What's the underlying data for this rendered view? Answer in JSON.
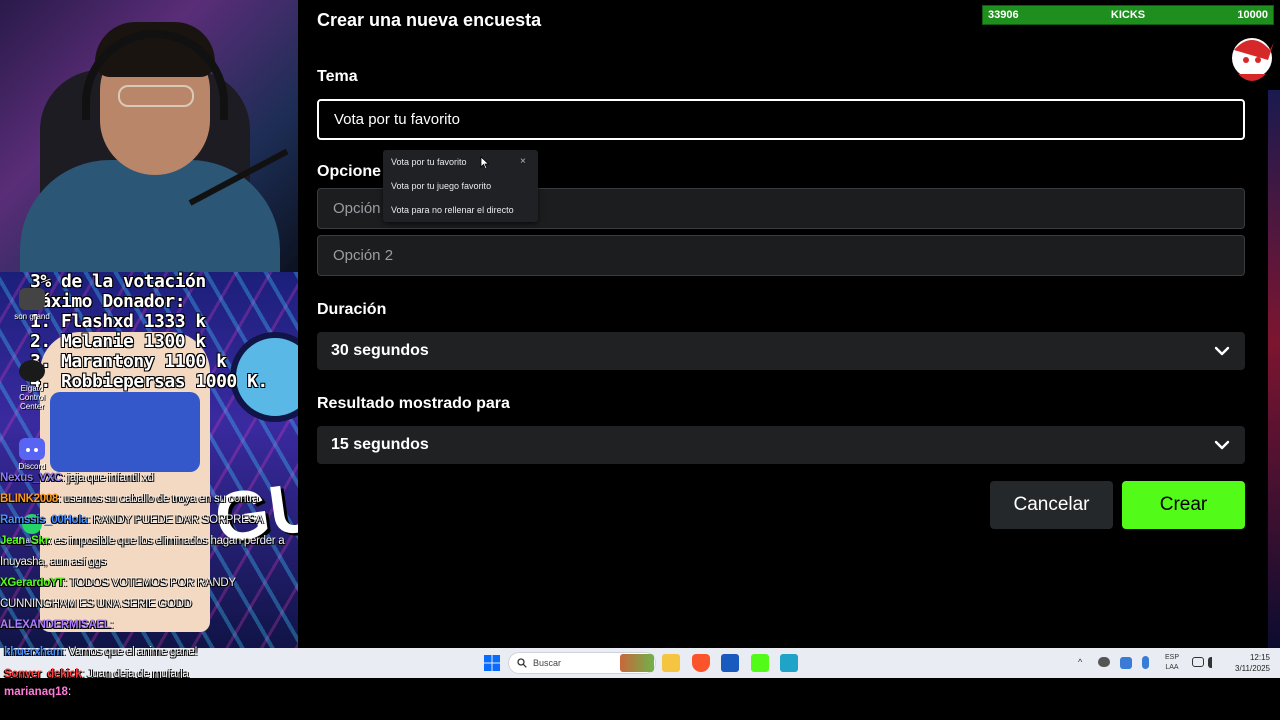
{
  "dialog": {
    "title": "Crear una nueva encuesta",
    "topic_label": "Tema",
    "topic_value": "Vota por tu favorito",
    "options_label": "Opcione",
    "option1_placeholder": "Opción",
    "option2_placeholder": "Opción 2",
    "duration_label": "Duración",
    "duration_value": "30 segundos",
    "result_label": "Resultado mostrado para",
    "result_value": "15 segundos",
    "cancel_label": "Cancelar",
    "create_label": "Crear",
    "accent_color": "#53fc18"
  },
  "autocomplete": {
    "items": [
      "Vota por tu favorito",
      "Vota por tu juego favorito",
      "Vota para no rellenar el directo"
    ],
    "close": "×"
  },
  "kicks": {
    "current": "33906",
    "label": "KICKS",
    "goal": "10000"
  },
  "donors": [
    "3% de la votación",
    "Máximo Donador:",
    "1. Flashxd 1333 k",
    "2. Melanie 1300 k",
    "3. Marantony 1100 k",
    "4. Robbiepersas 1000 K."
  ],
  "desktop": {
    "discord": "Discord",
    "elgato": "Elgato Control Center",
    "whatsapp": "WhatsApp",
    "sound": "son grand"
  },
  "chat": [
    {
      "user": "Nexus_VXC",
      "msg": ": jaja que infantil xd",
      "color": "#8e7cff"
    },
    {
      "user": "BLINK2008",
      "msg": ": usemos su caballo de troya en su contra",
      "color": "#ff9a1f"
    },
    {
      "user": "Ramssis_00Hola",
      "msg": ": RANDY PUEDE DAR SORPRESA",
      "color": "#4a90ff"
    },
    {
      "user": "Jean_Skr",
      "msg": ": es imposible que los eliminados hagan perder a Inuyasha, aun así ggs",
      "color": "#53fc18"
    },
    {
      "user": "XGerardoYT",
      "msg": ": TODOS VOTEMOS POR RANDY CUNNINGHAM ES UNA SERIE GODD",
      "color": "#53fc18"
    },
    {
      "user": "ALEXANDERMISAEL",
      "msg": ":",
      "color": "#b07cff"
    },
    {
      "user": "khuerxham",
      "msg": ": Vamos que el anime gane!",
      "color": "#4a90ff"
    },
    {
      "user": "Sonyer_dekick",
      "msg": ": Juan deja de mufarla",
      "color": "#ff3b3b"
    }
  ],
  "bottom_chat": {
    "user": "marianaq18",
    "msg": ":",
    "color": "#ff7ad9"
  },
  "taskbar": {
    "search_placeholder": "Buscar",
    "lang_top": "ESP",
    "lang_bottom": "LAA",
    "time": "12:15",
    "date": "3/11/2025"
  }
}
